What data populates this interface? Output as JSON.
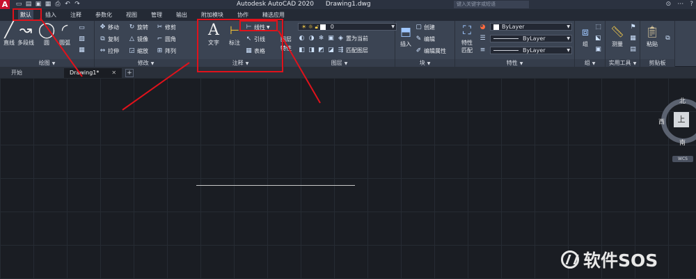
{
  "titlebar": {
    "logo": "A",
    "app_title": "Autodesk AutoCAD 2020",
    "doc_title": "Drawing1.dwg",
    "search_placeholder": "键入关键字或短语",
    "window_controls": [
      "⊙",
      "⋯",
      "?"
    ]
  },
  "menubar": {
    "tabs": [
      "默认",
      "插入",
      "注释",
      "参数化",
      "视图",
      "管理",
      "输出",
      "附加模块",
      "协作",
      "精选应用"
    ]
  },
  "ribbon": {
    "draw": {
      "label": "绘图",
      "line": "直线",
      "polyline": "多段线",
      "circle": "圆",
      "arc": "圆弧"
    },
    "modify": {
      "label": "修改",
      "move": "移动",
      "rotate": "旋转",
      "trim": "修剪",
      "copy": "复制",
      "mirror": "镜像",
      "fillet": "圆角",
      "stretch": "拉伸",
      "scale": "缩放",
      "array": "阵列"
    },
    "annotation": {
      "label": "注释",
      "text": "文字",
      "dimension": "标注",
      "linear": "线性",
      "leader": "引线",
      "table": "表格"
    },
    "layers": {
      "label": "图层",
      "layer_properties": "图层特性",
      "layer_value": "0",
      "set_current": "置为当前",
      "match_layer": "匹配图层"
    },
    "block": {
      "label": "块",
      "insert": "插入",
      "create": "创建",
      "edit": "编辑",
      "edit_attributes": "编辑属性"
    },
    "properties": {
      "label": "特性",
      "match": "特性匹配",
      "color": "ByLayer",
      "linetype": "ByLayer",
      "lineweight": "ByLayer"
    },
    "groups": {
      "label": "组",
      "group": "组"
    },
    "utilities": {
      "label": "实用工具",
      "measure": "测量"
    },
    "clipboard": {
      "label": "剪贴板",
      "paste": "粘贴"
    }
  },
  "doc_tabs": {
    "start": "开始",
    "drawing": "Drawing1*",
    "close": "✕",
    "add": "+"
  },
  "viewcube": {
    "north": "北",
    "west": "西",
    "south": "南",
    "face": "上",
    "wcs": "WCS"
  },
  "watermark": "软件SOS",
  "colors": {
    "annotation_red": "#e0121b",
    "autocad_red": "#c8102e",
    "canvas": "#1a1d23",
    "ribbon": "#3b4453"
  }
}
